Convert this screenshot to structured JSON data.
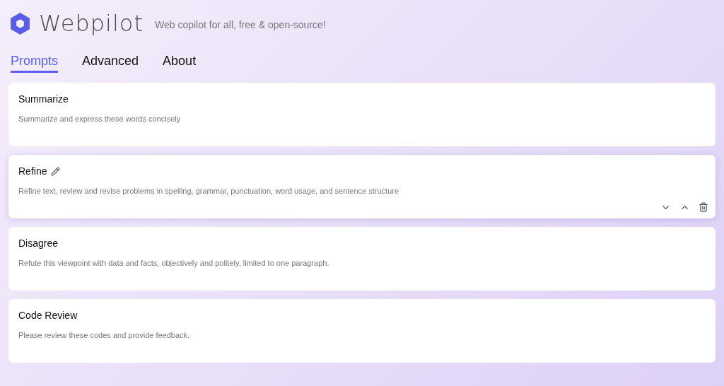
{
  "header": {
    "title": "Webpilot",
    "tagline": "Web copilot for all, free & open-source!"
  },
  "tabs": [
    {
      "label": "Prompts",
      "selected": true
    },
    {
      "label": "Advanced",
      "selected": false
    },
    {
      "label": "About",
      "selected": false
    }
  ],
  "prompts": [
    {
      "title": "Summarize",
      "description": "Summarize and express these words concisely",
      "hovered": false
    },
    {
      "title": "Refine",
      "description": "Refine text, review and revise problems in spelling, grammar, punctuation, word usage, and sentence structure",
      "hovered": true
    },
    {
      "title": "Disagree",
      "description": "Refute this viewpoint with data and facts, objectively and politely, limited to one paragraph.",
      "hovered": false
    },
    {
      "title": "Code Review",
      "description": "Please review these codes and provide feedback.",
      "hovered": false
    }
  ]
}
